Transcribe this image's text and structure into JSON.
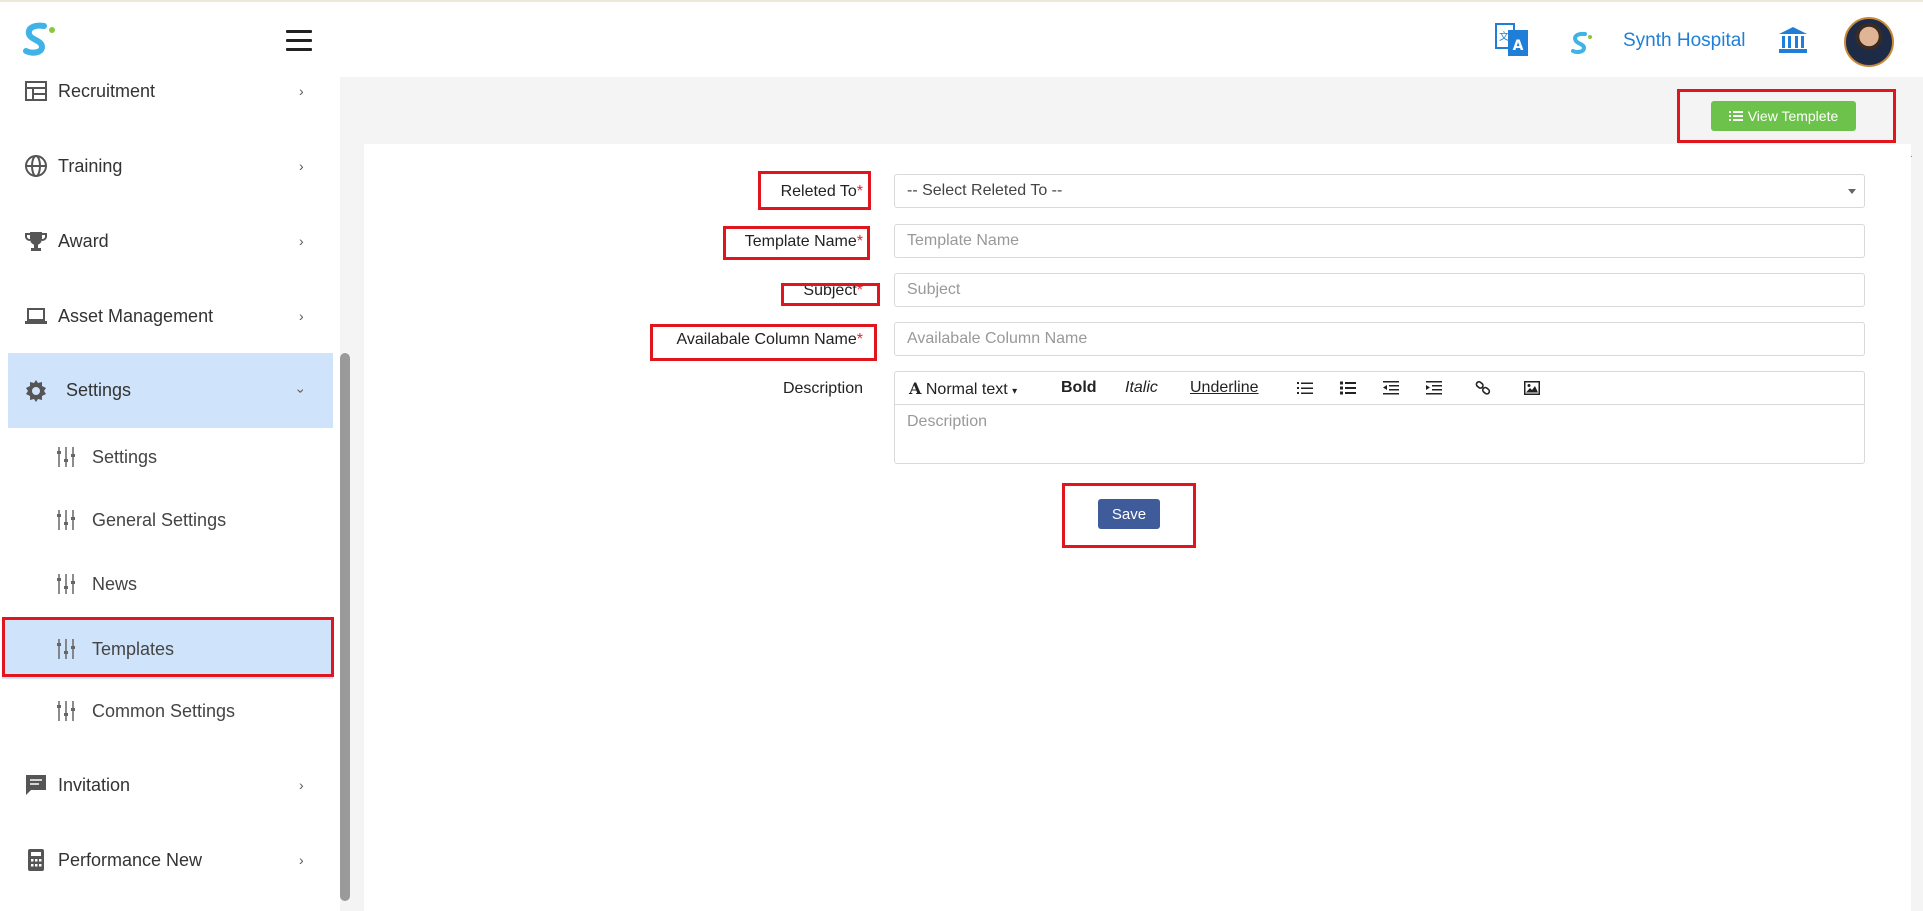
{
  "header": {
    "company_name": "Synth Hospital"
  },
  "sidebar": {
    "items": [
      {
        "label": "Recruitment",
        "icon": "table-icon"
      },
      {
        "label": "Training",
        "icon": "globe-icon"
      },
      {
        "label": "Award",
        "icon": "trophy-icon"
      },
      {
        "label": "Asset Management",
        "icon": "laptop-icon"
      },
      {
        "label": "Settings",
        "icon": "gear-icon"
      },
      {
        "label": "Invitation",
        "icon": "message-icon"
      },
      {
        "label": "Performance New",
        "icon": "calculator-icon"
      }
    ],
    "settings_submenu": [
      {
        "label": "Settings"
      },
      {
        "label": "General Settings"
      },
      {
        "label": "News"
      },
      {
        "label": "Templates"
      },
      {
        "label": "Common Settings"
      }
    ]
  },
  "toolbar": {
    "view_template_label": "View Templete"
  },
  "form": {
    "related_to_label": "Releted To",
    "related_to_value": "-- Select Releted To --",
    "template_name_label": "Template Name",
    "template_name_placeholder": "Template Name",
    "subject_label": "Subject",
    "subject_placeholder": "Subject",
    "columns_label": "Availabale Column Name",
    "columns_placeholder": "Availabale Column Name",
    "description_label": "Description",
    "required_mark": "*",
    "save_label": "Save"
  },
  "editor": {
    "format_label": "Normal text",
    "bold_label": "Bold",
    "italic_label": "Italic",
    "underline_label": "Underline",
    "placeholder": "Description"
  },
  "colors": {
    "accent_blue": "#1f7fd8",
    "active_bg": "#cfe3fb",
    "view_button": "#6cc24a",
    "save_button": "#3f5b9a",
    "highlight_red": "#e0151d"
  }
}
